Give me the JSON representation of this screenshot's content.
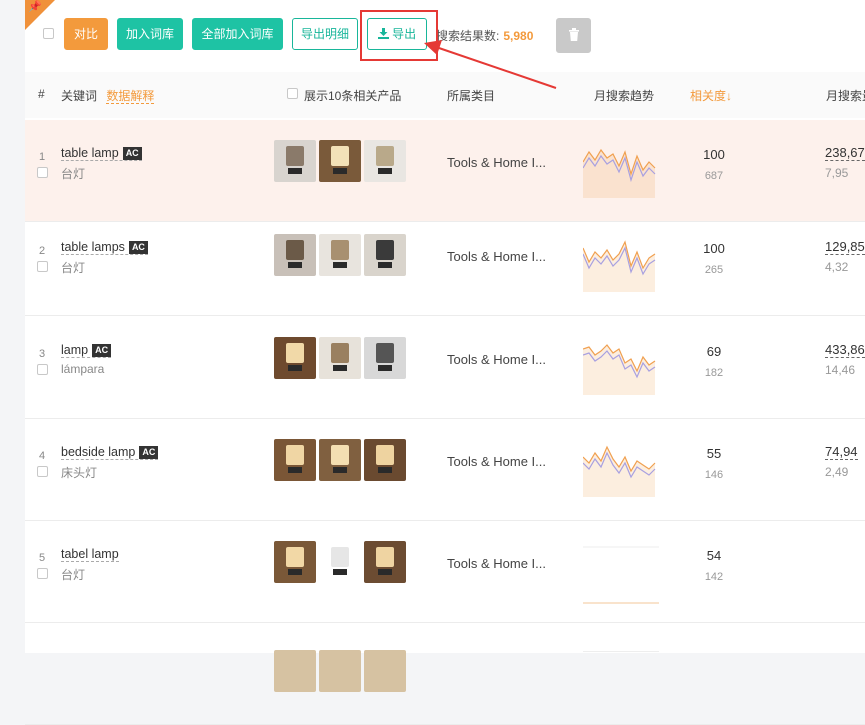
{
  "toolbar": {
    "compare": "对比",
    "add_to_library": "加入词库",
    "add_all_to_library": "全部加入词库",
    "export_details": "导出明细",
    "export": "导出",
    "result_label": "搜索结果数:",
    "result_count": "5,980"
  },
  "table": {
    "headers": {
      "index": "#",
      "keyword": "关键词",
      "keyword_help": "数据解释",
      "show_products": "展示10条相关产品",
      "category": "所属类目",
      "trend": "月搜索趋势",
      "relevance": "相关度↓",
      "monthly_search": "月搜索量"
    },
    "rows": [
      {
        "index": "1",
        "keyword": "table lamp",
        "badge": "AC",
        "translation": "台灯",
        "category": "Tools & Home I...",
        "relevance": "100",
        "relevance_sub": "687",
        "volume": "238,67",
        "volume_sub": "7,95",
        "has_trend": true
      },
      {
        "index": "2",
        "keyword": "table lamps",
        "badge": "AC",
        "translation": "台灯",
        "category": "Tools & Home I...",
        "relevance": "100",
        "relevance_sub": "265",
        "volume": "129,85",
        "volume_sub": "4,32",
        "has_trend": true
      },
      {
        "index": "3",
        "keyword": "lamp",
        "badge": "AC",
        "translation": "lámpara",
        "category": "Tools & Home I...",
        "relevance": "69",
        "relevance_sub": "182",
        "volume": "433,86",
        "volume_sub": "14,46",
        "has_trend": true
      },
      {
        "index": "4",
        "keyword": "bedside lamp",
        "badge": "AC",
        "translation": "床头灯",
        "category": "Tools & Home I...",
        "relevance": "55",
        "relevance_sub": "146",
        "volume": "74,94",
        "volume_sub": "2,49",
        "has_trend": true
      },
      {
        "index": "5",
        "keyword": "tabel lamp",
        "badge": "",
        "translation": "台灯",
        "category": "Tools & Home I...",
        "relevance": "54",
        "relevance_sub": "142",
        "volume": "",
        "volume_sub": "",
        "has_trend": false
      }
    ]
  },
  "colors": {
    "accent_orange": "#f39a3c",
    "teal": "#1ec3a4",
    "highlight_red": "#e53935",
    "trend_orange": "#f0a050",
    "trend_purple": "#a8a0e0"
  },
  "icons": {
    "pin": "pushpin-icon",
    "export": "download-icon",
    "delete": "trash-icon"
  }
}
